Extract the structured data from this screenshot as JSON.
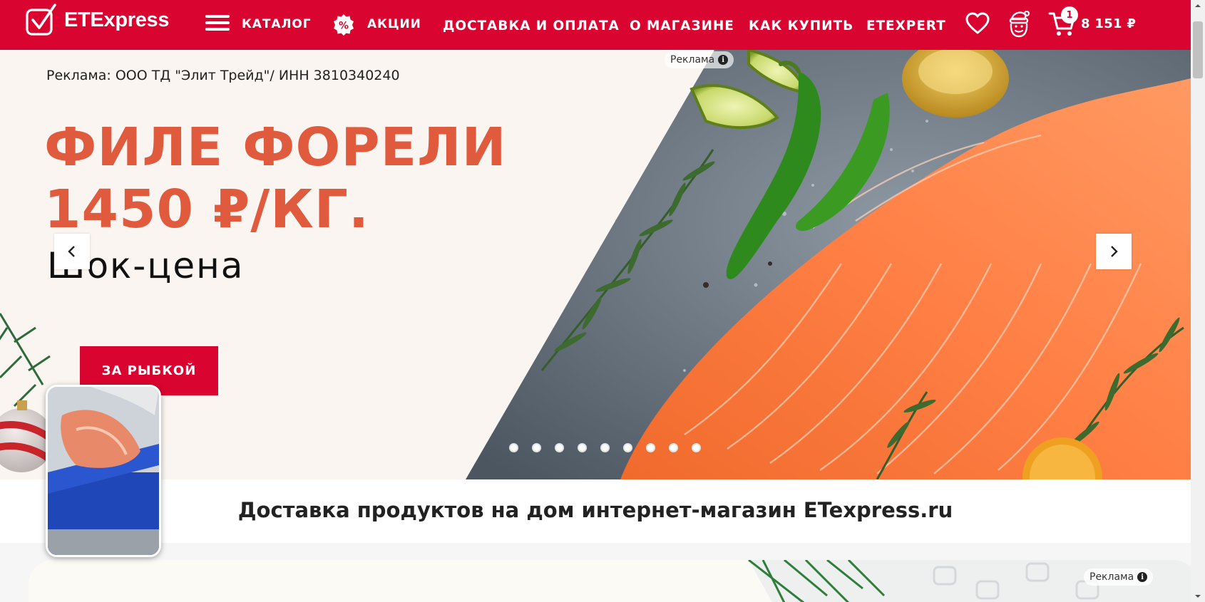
{
  "header": {
    "logo_text": "ETExpress",
    "catalog_label": "КАТАЛОГ",
    "promo_label": "АКЦИИ",
    "promo_badge": "%",
    "nav": [
      "ДОСТАВКА И ОПЛАТА",
      "О МАГАЗИНЕ",
      "КАК КУПИТЬ",
      "ETEXPERT"
    ],
    "cart_count": "1",
    "cart_total": "8 151 ₽",
    "icons": [
      "burger-menu-icon",
      "percent-badge-icon",
      "heart-icon",
      "santa-icon",
      "cart-icon"
    ]
  },
  "banner": {
    "ad_disclosure": "Реклама: ООО ТД \"Элит Трейд\"/ ИНН 3810340240",
    "ad_label": "Реклама",
    "headline_line1": "ФИЛЕ ФОРЕЛИ",
    "headline_line2": "1450 ₽/КГ.",
    "subline": "Шок-цена",
    "cta_label": "ЗА РЫБКОЙ",
    "slide_count": 9,
    "active_slide": 6
  },
  "main": {
    "title": "Доставка продуктов на дом интернет-магазин ETexpress.ru"
  },
  "next_section": {
    "ad_label": "Реклама"
  },
  "colors": {
    "brand_red": "#d9042f",
    "headline_orange": "#e05a3e",
    "banner_bg": "#faf5f0"
  }
}
